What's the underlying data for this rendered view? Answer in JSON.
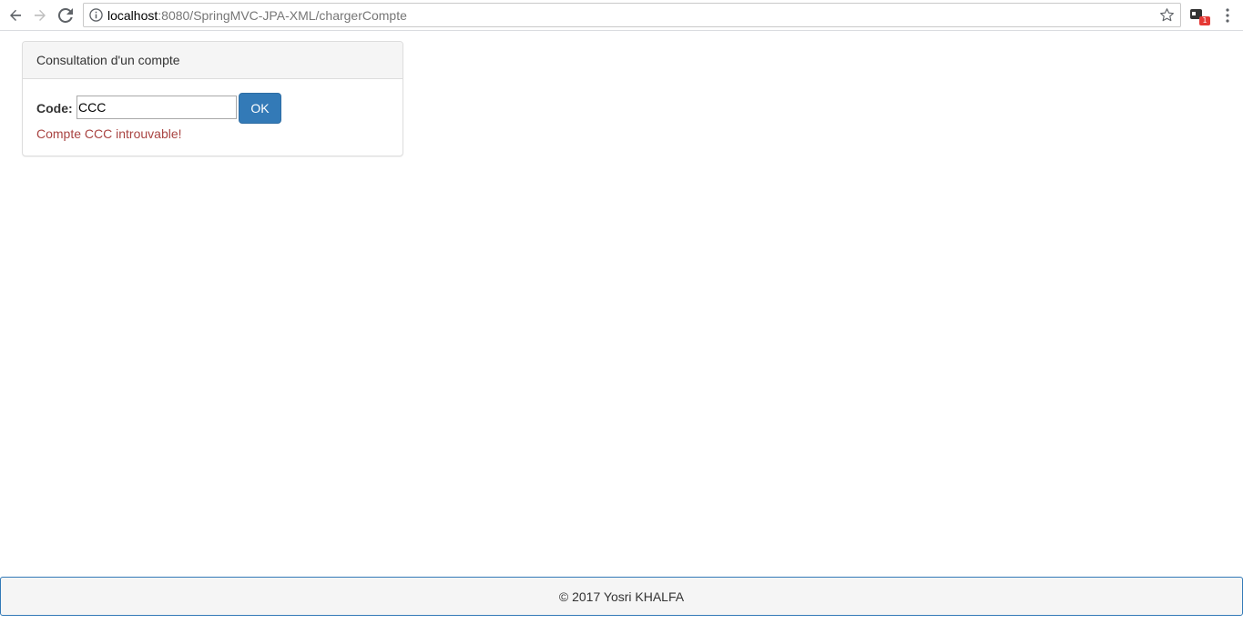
{
  "browser": {
    "url_host": "localhost",
    "url_rest": ":8080/SpringMVC-JPA-XML/chargerCompte",
    "extension_badge": "1",
    "icons": {
      "back": "back-arrow-icon",
      "forward": "forward-arrow-icon",
      "reload": "reload-icon",
      "info": "info-icon",
      "star": "star-icon",
      "extension": "extension-icon",
      "menu": "kebab-menu-icon"
    }
  },
  "panel": {
    "heading": "Consultation d'un compte",
    "code_label": "Code:",
    "code_value": "CCC",
    "ok_label": "OK",
    "error_message": "Compte CCC introuvable!"
  },
  "footer": {
    "text": "© 2017 Yosri KHALFA"
  },
  "colors": {
    "primary": "#337ab7",
    "error": "#a94442",
    "panel_heading_bg": "#f5f5f5"
  }
}
